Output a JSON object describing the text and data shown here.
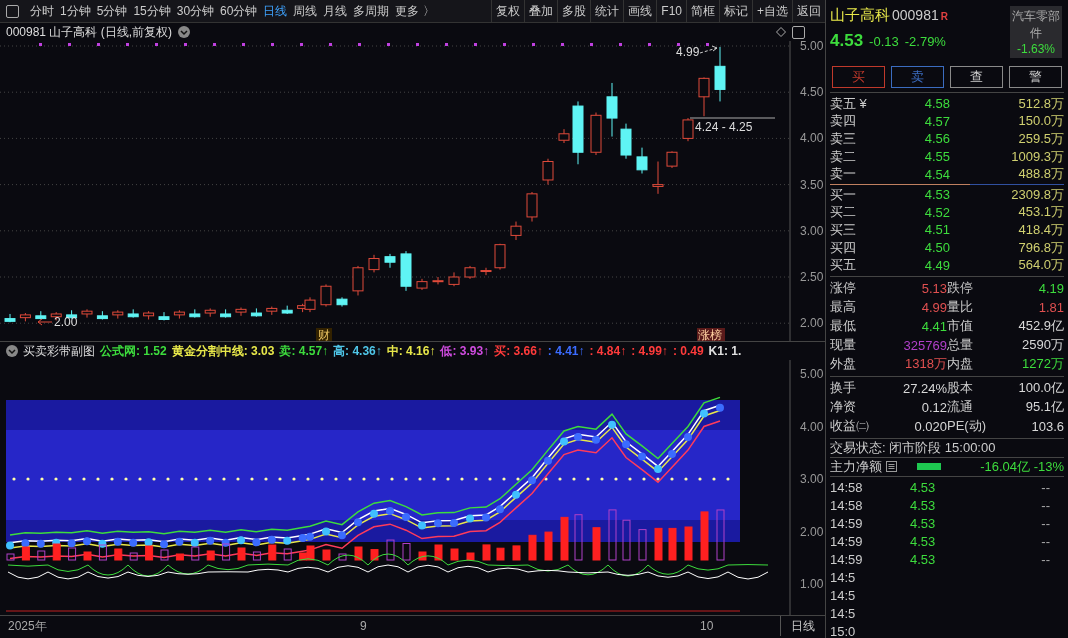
{
  "toolbar": {
    "periods": [
      {
        "label": "分时",
        "selected": false
      },
      {
        "label": "1分钟",
        "selected": false
      },
      {
        "label": "5分钟",
        "selected": false
      },
      {
        "label": "15分钟",
        "selected": false
      },
      {
        "label": "30分钟",
        "selected": false
      },
      {
        "label": "60分钟",
        "selected": false
      },
      {
        "label": "日线",
        "selected": true
      },
      {
        "label": "周线",
        "selected": false
      },
      {
        "label": "月线",
        "selected": false
      },
      {
        "label": "多周期",
        "selected": false
      },
      {
        "label": "更多 〉",
        "selected": false
      }
    ],
    "buttons": [
      "复权",
      "叠加",
      "多股",
      "统计",
      "画线",
      "F10",
      "简框",
      "标记",
      "+自选",
      "返回"
    ]
  },
  "chart_title": "000981 山子高科 (日线,前复权)",
  "price_axis": [
    "5.00",
    "4.50",
    "4.00",
    "3.50",
    "3.00",
    "2.50",
    "2.00"
  ],
  "annotations": {
    "high": "4.99",
    "range": "4.24 - 4.25",
    "low": "2.00",
    "markers": [
      "财",
      "涨榜"
    ]
  },
  "indicator": {
    "name": "买卖彩带副图",
    "values": [
      {
        "label": "公式网:",
        "value": "1.52",
        "color": "#3ddc3d"
      },
      {
        "label": "黄金分割中线:",
        "value": "3.03",
        "color": "#e8e84a"
      },
      {
        "label": "卖:",
        "value": "4.57",
        "arrow": "↑",
        "color": "#3ddc3d"
      },
      {
        "label": "高:",
        "value": "4.36",
        "arrow": "↑",
        "color": "#4fc6e8"
      },
      {
        "label": "中:",
        "value": "4.16",
        "arrow": "↑",
        "color": "#e8e84a"
      },
      {
        "label": "低:",
        "value": "3.93",
        "arrow": "↑",
        "color": "#d04ce0"
      },
      {
        "label": "买:",
        "value": "3.66",
        "arrow": "↑",
        "color": "#ff3b3b"
      },
      {
        "label": ":",
        "value": "4.41",
        "arrow": "↑",
        "color": "#3b6cff"
      },
      {
        "label": ":",
        "value": "4.84",
        "arrow": "↑",
        "color": "#ff3b3b"
      },
      {
        "label": ":",
        "value": "4.99",
        "arrow": "↑",
        "color": "#ff3b3b"
      },
      {
        "label": ":",
        "value": "0.49",
        "color": "#ff3b3b"
      },
      {
        "label": "K1:",
        "value": "1.",
        "color": "#e0e0e0"
      }
    ]
  },
  "indicator_axis": [
    "5.00",
    "4.00",
    "3.00",
    "2.00",
    "1.00"
  ],
  "date_axis": {
    "labels": [
      "2025年",
      "9",
      "10"
    ],
    "period": "日线"
  },
  "quote": {
    "name": "山子高科",
    "code": "000981",
    "badge": "R",
    "price": "4.53",
    "change": "-0.13",
    "percent": "-2.79%",
    "sector": "汽车零部件",
    "sector_percent": "-1.63%",
    "buttons": [
      {
        "label": "买",
        "color": "#c0392b"
      },
      {
        "label": "卖",
        "color": "#3b6cc0"
      },
      {
        "label": "查",
        "color": "#8a8a8a"
      },
      {
        "label": "警",
        "color": "#8a8a8a"
      }
    ]
  },
  "asks": [
    {
      "label": "卖五 ¥",
      "price": "4.58",
      "volume": "512.8万"
    },
    {
      "label": "卖四",
      "price": "4.57",
      "volume": "150.0万"
    },
    {
      "label": "卖三",
      "price": "4.56",
      "volume": "259.5万"
    },
    {
      "label": "卖二",
      "price": "4.55",
      "volume": "1009.3万"
    },
    {
      "label": "卖一",
      "price": "4.54",
      "volume": "488.8万"
    }
  ],
  "bids": [
    {
      "label": "买一",
      "price": "4.53",
      "volume": "2309.8万"
    },
    {
      "label": "买二",
      "price": "4.52",
      "volume": "453.1万"
    },
    {
      "label": "买三",
      "price": "4.51",
      "volume": "418.4万"
    },
    {
      "label": "买四",
      "price": "4.50",
      "volume": "796.8万"
    },
    {
      "label": "买五",
      "price": "4.49",
      "volume": "564.0万"
    }
  ],
  "stats": [
    {
      "label": "涨停",
      "value": "5.13",
      "color": "#e05050"
    },
    {
      "label": "跌停",
      "value": "4.19",
      "color": "#3ddc3d"
    },
    {
      "label": "最高",
      "value": "4.99",
      "color": "#e05050"
    },
    {
      "label": "量比",
      "value": "1.81",
      "color": "#e05050"
    },
    {
      "label": "最低",
      "value": "4.41",
      "color": "#3ddc3d"
    },
    {
      "label": "市值",
      "value": "452.9亿",
      "color": "#d8d8d8"
    },
    {
      "label": "现量",
      "value": "325769",
      "color": "#b040c8"
    },
    {
      "label": "总量",
      "value": "2590万",
      "color": "#d8d8d8"
    },
    {
      "label": "外盘",
      "value": "1318万",
      "color": "#e05050"
    },
    {
      "label": "内盘",
      "value": "1272万",
      "color": "#3ddc3d"
    }
  ],
  "fundamentals": [
    {
      "label": "换手",
      "value": "27.24%"
    },
    {
      "label": "股本",
      "value": "100.0亿"
    },
    {
      "label": "净资",
      "value": "0.12"
    },
    {
      "label": "流通",
      "value": "95.1亿"
    },
    {
      "label": "收益㈡",
      "value": "0.020"
    },
    {
      "label": "PE(动)",
      "value": "103.6"
    }
  ],
  "trade_state": "交易状态: 闭市阶段 15:00:00",
  "main_force": {
    "label": "主力净额",
    "value": "-16.04亿 -13%"
  },
  "ticks": [
    {
      "time": "14:58",
      "price": "4.53",
      "volume": "--"
    },
    {
      "time": "14:58",
      "price": "4.53",
      "volume": "--"
    },
    {
      "time": "14:59",
      "price": "4.53",
      "volume": "--"
    },
    {
      "time": "14:59",
      "price": "4.53",
      "volume": "--"
    },
    {
      "time": "14:59",
      "price": "4.53",
      "volume": "--"
    },
    {
      "time": "14:5"
    },
    {
      "time": "14:5"
    },
    {
      "time": "14:5"
    },
    {
      "time": "15:0"
    }
  ]
}
